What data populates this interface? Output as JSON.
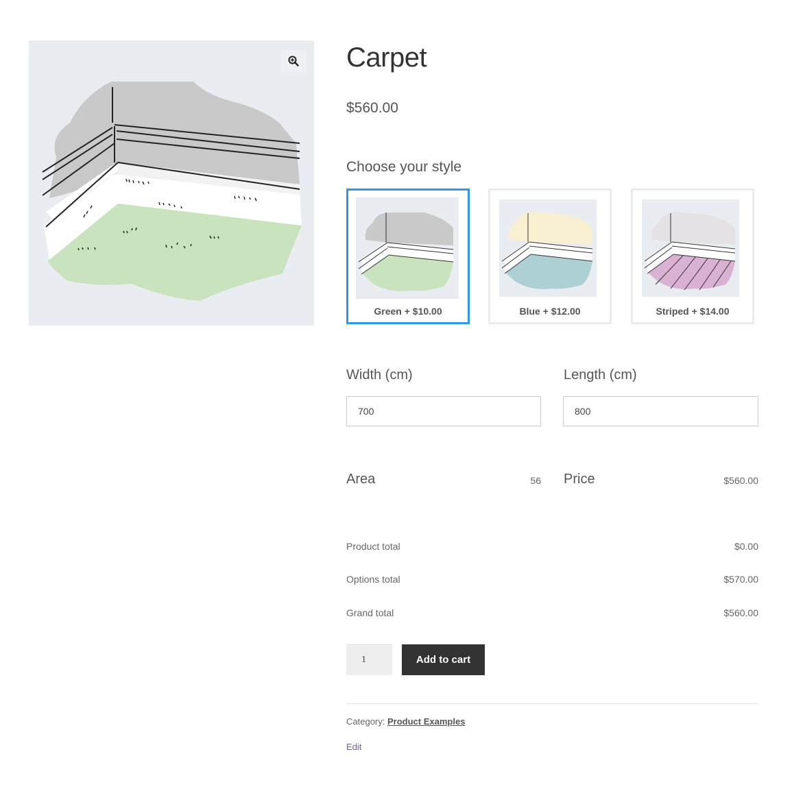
{
  "product": {
    "title": "Carpet",
    "price": "$560.00",
    "image_alt": "carpet-green-illustration"
  },
  "style_picker": {
    "label": "Choose your style",
    "options": [
      {
        "label": "Green + $10.00",
        "selected": true,
        "floor_color": "#c8e3bd",
        "wall_color": "#c9c9c9"
      },
      {
        "label": "Blue + $12.00",
        "selected": false,
        "floor_color": "#acd0d3",
        "wall_color": "#f9f0d2"
      },
      {
        "label": "Striped + $14.00",
        "selected": false,
        "floor_color": "#d9b1d3",
        "wall_color": "#e5e1e5"
      }
    ]
  },
  "dimensions": {
    "width_label": "Width (cm)",
    "width_value": "700",
    "length_label": "Length (cm)",
    "length_value": "800"
  },
  "calculated": {
    "area_label": "Area",
    "area_value": "56",
    "price_label": "Price",
    "price_value": "$560.00"
  },
  "totals": [
    {
      "label": "Product total",
      "value": "$0.00"
    },
    {
      "label": "Options total",
      "value": "$570.00"
    },
    {
      "label": "Grand total",
      "value": "$560.00"
    }
  ],
  "cart": {
    "quantity": "1",
    "add_to_cart_label": "Add to cart"
  },
  "meta": {
    "category_label": "Category:",
    "category_link": "Product Examples",
    "edit_label": "Edit"
  },
  "colors": {
    "selected_border": "#2e97e6",
    "button_bg": "#333333",
    "edit_link": "#7f54b3"
  },
  "icons": {
    "zoom": "magnifier-plus-icon"
  }
}
